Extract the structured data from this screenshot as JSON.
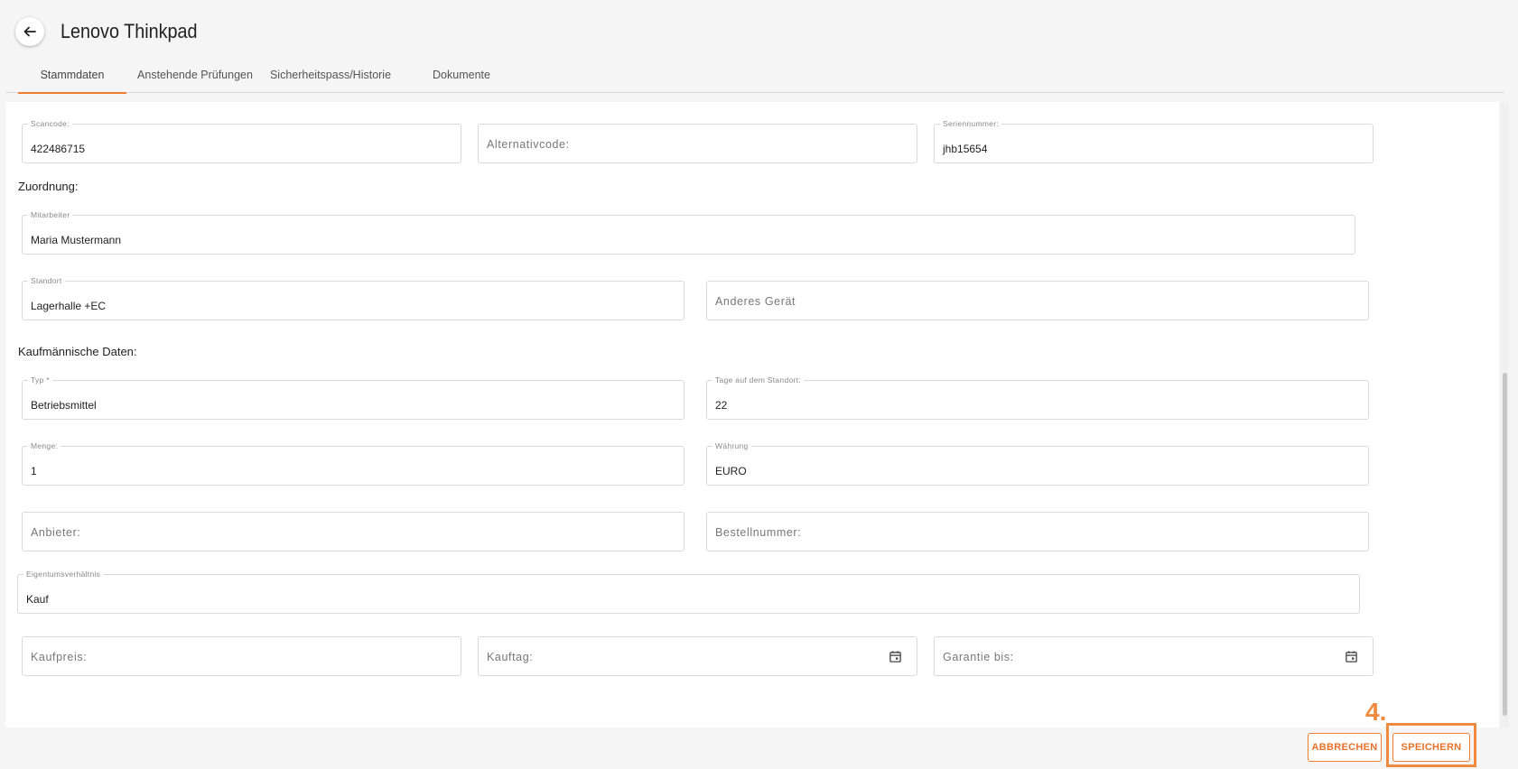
{
  "header": {
    "title": "Lenovo Thinkpad"
  },
  "tabs": [
    {
      "label": "Stammdaten",
      "active": true
    },
    {
      "label": "Anstehende Prüfungen"
    },
    {
      "label": "Sicherheitspass/Historie"
    },
    {
      "label": "Dokumente"
    }
  ],
  "fields": {
    "scancode": {
      "label": "Scancode:",
      "value": "422486715"
    },
    "alternativcode": {
      "placeholder": "Alternativcode:"
    },
    "seriennummer": {
      "label": "Seriennummer:",
      "value": "jhb15654"
    },
    "mitarbeiter": {
      "label": "Mitarbeiter",
      "value": "Maria Mustermann"
    },
    "standort": {
      "label": "Standort",
      "value": "Lagerhalle +EC"
    },
    "anderes_geraet": {
      "placeholder": "Anderes Gerät"
    },
    "typ": {
      "label": "Typ *",
      "value": "Betriebsmittel"
    },
    "tage": {
      "label": "Tage auf dem Standort:",
      "value": "22"
    },
    "menge": {
      "label": "Menge:",
      "value": "1"
    },
    "waehrung": {
      "label": "Währung",
      "value": "EURO"
    },
    "anbieter": {
      "placeholder": "Anbieter:"
    },
    "bestellnummer": {
      "placeholder": "Bestellnummer:"
    },
    "eigentum": {
      "label": "Eigentumsverhältnis",
      "value": "Kauf"
    },
    "kaufpreis": {
      "placeholder": "Kaufpreis:"
    },
    "kauftag": {
      "placeholder": "Kauftag:"
    },
    "garantie": {
      "placeholder": "Garantie bis:"
    }
  },
  "sections": {
    "zuordnung": "Zuordnung:",
    "kaufmaennisch": "Kaufmännische Daten:"
  },
  "footer": {
    "cancel_label": "ABBRECHEN",
    "save_label": "SPEICHERN"
  },
  "annotation": {
    "step": "4."
  },
  "colors": {
    "accent": "#ee7d2f",
    "highlight": "#f08a3e"
  },
  "icons": {
    "back": "arrow-left-icon",
    "calendar": "calendar-icon"
  }
}
